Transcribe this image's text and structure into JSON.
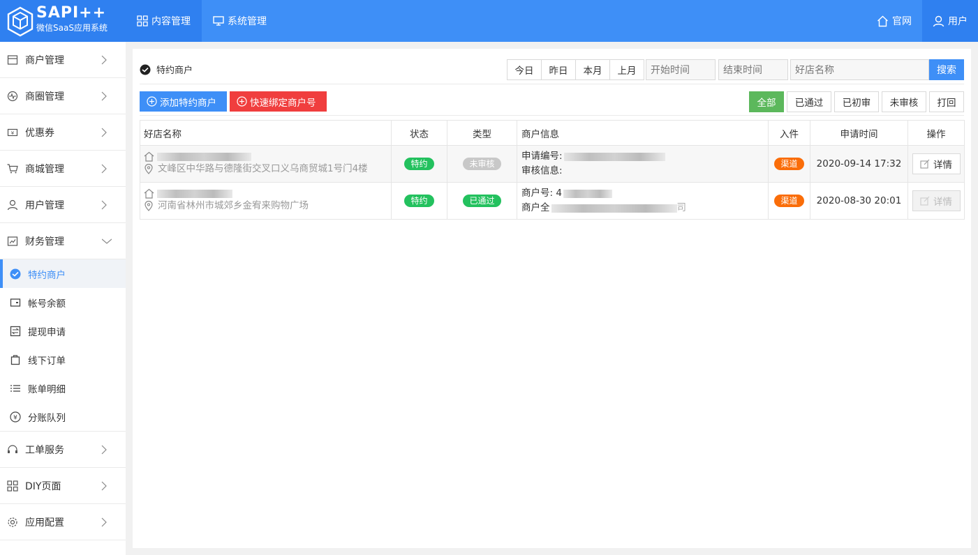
{
  "brand": {
    "title": "SAPI++",
    "subtitle": "微信SaaS应用系统"
  },
  "topnav": [
    {
      "label": "内容管理",
      "icon": "grid-icon",
      "active": true
    },
    {
      "label": "系统管理",
      "icon": "monitor-icon",
      "active": false
    }
  ],
  "topright": {
    "home": "官网",
    "user": "用户"
  },
  "sidebar": {
    "items": [
      {
        "label": "商户管理",
        "icon": "store-icon"
      },
      {
        "label": "商圈管理",
        "icon": "pulse-icon"
      },
      {
        "label": "优惠券",
        "icon": "coupon-icon"
      },
      {
        "label": "商城管理",
        "icon": "cart-icon"
      },
      {
        "label": "用户管理",
        "icon": "user-icon"
      },
      {
        "label": "财务管理",
        "icon": "chart-icon",
        "expanded": true
      }
    ],
    "finance_sub": [
      {
        "label": "特约商户",
        "icon": "wechatpay-icon",
        "active": true
      },
      {
        "label": "帐号余额",
        "icon": "wallet-icon"
      },
      {
        "label": "提现申请",
        "icon": "transfer-icon"
      },
      {
        "label": "线下订单",
        "icon": "bag-icon"
      },
      {
        "label": "账单明细",
        "icon": "list-icon"
      },
      {
        "label": "分账队列",
        "icon": "yen-icon"
      }
    ],
    "bottom_items": [
      {
        "label": "工单服务",
        "icon": "headset-icon"
      },
      {
        "label": "DIY页面",
        "icon": "grid-icon"
      },
      {
        "label": "应用配置",
        "icon": "gear-icon"
      }
    ]
  },
  "page": {
    "title": "特约商户",
    "quick_dates": [
      "今日",
      "昨日",
      "本月",
      "上月"
    ],
    "start_placeholder": "开始时间",
    "end_placeholder": "结束时间",
    "name_placeholder": "好店名称",
    "search_label": "搜索",
    "add_button": "添加特约商户",
    "bind_button": "快速绑定商户号",
    "status_filters": [
      "全部",
      "已通过",
      "已初审",
      "未审核",
      "打回"
    ],
    "active_status": "全部"
  },
  "table": {
    "columns": [
      "好店名称",
      "状态",
      "类型",
      "商户信息",
      "入件",
      "申请时间",
      "操作"
    ],
    "rows": [
      {
        "address": "文峰区中华路与德隆街交叉口义乌商贸城1号门4楼",
        "status": "特约",
        "type": "未审核",
        "info_line1": "申请编号:",
        "info_line2": "审核信息:",
        "channel": "渠道",
        "time": "2020-09-14 17:32",
        "action": "详情"
      },
      {
        "address": "河南省林州市城郊乡金宥来购物广场",
        "status": "特约",
        "type": "已通过",
        "info_line1": "商户号: 4",
        "info_line2": "商户全",
        "info_line2_tail": "司",
        "channel": "渠道",
        "time": "2020-08-30 20:01",
        "action": "详情"
      }
    ]
  },
  "colors": {
    "primary": "#3e8ff7",
    "danger": "#f03e3e",
    "success": "#5cb85c",
    "badge_green": "#23c15e",
    "badge_orange": "#fa6d09"
  }
}
